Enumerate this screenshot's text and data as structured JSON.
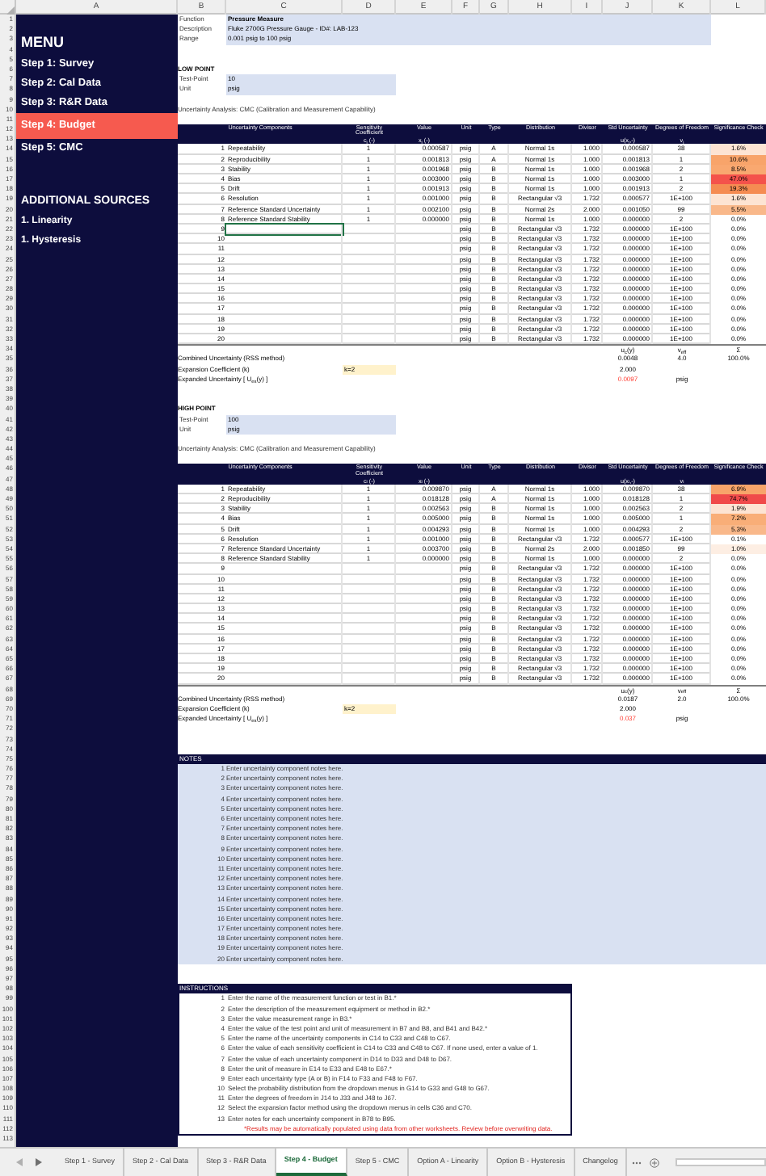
{
  "column_letters": [
    "A",
    "B",
    "C",
    "D",
    "E",
    "F",
    "G",
    "H",
    "I",
    "J",
    "K",
    "L"
  ],
  "row_numbers": [
    "1",
    "2",
    "3",
    "4",
    "5",
    "6",
    "7",
    "8",
    "9",
    "10",
    "11",
    "12",
    "13",
    "14",
    "15",
    "16",
    "17",
    "18",
    "19",
    "20",
    "21",
    "22",
    "23",
    "24",
    "25",
    "26",
    "27",
    "28",
    "29",
    "30",
    "31",
    "32",
    "33",
    "34",
    "35",
    "36",
    "37",
    "38",
    "39",
    "40",
    "41",
    "42",
    "43",
    "44",
    "45",
    "46",
    "47",
    "48",
    "49",
    "50",
    "51",
    "52",
    "53",
    "54",
    "55",
    "56",
    "57",
    "58",
    "59",
    "60",
    "61",
    "62",
    "63",
    "64",
    "65",
    "66",
    "67",
    "68",
    "69",
    "70",
    "71",
    "72",
    "73",
    "74",
    "75",
    "76",
    "77",
    "78",
    "79",
    "80",
    "81",
    "82",
    "83",
    "84",
    "85",
    "86",
    "87",
    "88",
    "89",
    "90",
    "91",
    "92",
    "93",
    "94",
    "95",
    "96",
    "97",
    "98",
    "99",
    "100",
    "101",
    "102",
    "103",
    "104",
    "105",
    "106",
    "107",
    "108",
    "109",
    "110",
    "111",
    "112",
    "113"
  ],
  "sidebar": {
    "title": "MENU",
    "items": [
      {
        "label": "Step 1: Survey",
        "selected": false
      },
      {
        "label": "Step 2: Cal Data",
        "selected": false
      },
      {
        "label": "Step 3: R&R Data",
        "selected": false
      },
      {
        "label": "Step 4: Budget",
        "selected": true
      },
      {
        "label": "Step 5: CMC",
        "selected": false
      }
    ],
    "section_title": "ADDITIONAL SOURCES",
    "links": [
      "1. Linearity",
      "1. Hysteresis"
    ]
  },
  "info": [
    {
      "label": "Function",
      "value": "Pressure Measure"
    },
    {
      "label": "Description",
      "value": "Fluke 2700G Pressure Gauge - ID#: LAB-123"
    },
    {
      "label": "Range",
      "value": "0.001 psig to 100 psig"
    }
  ],
  "low_point": {
    "heading": "LOW POINT",
    "test_point": {
      "label": "Test-Point",
      "value": "10"
    },
    "unit": {
      "label": "Unit",
      "value": "psig"
    },
    "analysis_title": "Uncertainty Analysis: CMC (Calibration and Measurement Capability)",
    "columns": [
      "Uncertainty Components",
      "Sensitivity Coefficient",
      "Value",
      "Unit",
      "Type",
      "Distribution",
      "Divisor",
      "Std Uncertainty",
      "Degrees of Freedom",
      "Significance Check"
    ],
    "symbols": {
      "coefficient": "c$_{i}$ (-)",
      "value": "x$_{i}$ (-)",
      "std": "u(x$_{i}$,-)",
      "dof": "v$_{i}$"
    },
    "rows": [
      {
        "n": "1",
        "name": "Repeatability",
        "ci": "1",
        "value": "0.000587",
        "unit": "psig",
        "type": "A",
        "dist": "Normal 1s",
        "divisor": "1.000",
        "std": "0.000587",
        "dof": "38",
        "sig": "1.6%",
        "color": "#fde4d3",
        "selected": false
      },
      {
        "n": "2",
        "name": "Reproducibility",
        "ci": "1",
        "value": "0.001813",
        "unit": "psig",
        "type": "A",
        "dist": "Normal 1s",
        "divisor": "1.000",
        "std": "0.001813",
        "dof": "1",
        "sig": "10.6%",
        "color": "#f8a46a",
        "selected": false
      },
      {
        "n": "3",
        "name": "Stability",
        "ci": "1",
        "value": "0.001968",
        "unit": "psig",
        "type": "B",
        "dist": "Normal 1s",
        "divisor": "1.000",
        "std": "0.001968",
        "dof": "2",
        "sig": "8.5%",
        "color": "#f9a870",
        "selected": false
      },
      {
        "n": "4",
        "name": "Bias",
        "ci": "1",
        "value": "0.003000",
        "unit": "psig",
        "type": "B",
        "dist": "Normal 1s",
        "divisor": "1.000",
        "std": "0.003000",
        "dof": "1",
        "sig": "47.0%",
        "color": "#f4524b",
        "selected": false
      },
      {
        "n": "5",
        "name": "Drift",
        "ci": "1",
        "value": "0.001913",
        "unit": "psig",
        "type": "B",
        "dist": "Normal 1s",
        "divisor": "1.000",
        "std": "0.001913",
        "dof": "2",
        "sig": "19.3%",
        "color": "#f58c52",
        "selected": false
      },
      {
        "n": "6",
        "name": "Resolution",
        "ci": "1",
        "value": "0.001000",
        "unit": "psig",
        "type": "B",
        "dist": "Rectangular √3",
        "divisor": "1.732",
        "std": "0.000577",
        "dof": "1E+100",
        "sig": "1.6%",
        "color": "#fde4d3",
        "selected": false
      },
      {
        "n": "7",
        "name": "Reference Standard Uncertainty",
        "ci": "1",
        "value": "0.002100",
        "unit": "psig",
        "type": "B",
        "dist": "Normal 2s",
        "divisor": "2.000",
        "std": "0.001050",
        "dof": "99",
        "sig": "5.5%",
        "color": "#f9b88a",
        "selected": false
      },
      {
        "n": "8",
        "name": "Reference Standard Stability",
        "ci": "1",
        "value": "0.000000",
        "unit": "psig",
        "type": "B",
        "dist": "Normal 1s",
        "divisor": "1.000",
        "std": "0.000000",
        "dof": "2",
        "sig": "0.0%",
        "color": "#ffffff",
        "selected": false
      },
      {
        "n": "9",
        "unit": "psig",
        "type": "B",
        "dist": "Rectangular √3",
        "divisor": "1.732",
        "std": "0.000000",
        "dof": "1E+100",
        "sig": "0.0%",
        "color": "#ffffff",
        "selected": true
      },
      {
        "n": "10",
        "unit": "psig",
        "type": "B",
        "dist": "Rectangular √3",
        "divisor": "1.732",
        "std": "0.000000",
        "dof": "1E+100",
        "sig": "0.0%",
        "color": "#ffffff",
        "selected": false
      },
      {
        "n": "11",
        "unit": "psig",
        "type": "B",
        "dist": "Rectangular √3",
        "divisor": "1.732",
        "std": "0.000000",
        "dof": "1E+100",
        "sig": "0.0%",
        "color": "#ffffff",
        "selected": false
      },
      {
        "n": "12",
        "unit": "psig",
        "type": "B",
        "dist": "Rectangular √3",
        "divisor": "1.732",
        "std": "0.000000",
        "dof": "1E+100",
        "sig": "0.0%",
        "color": "#ffffff",
        "selected": false
      },
      {
        "n": "13",
        "unit": "psig",
        "type": "B",
        "dist": "Rectangular √3",
        "divisor": "1.732",
        "std": "0.000000",
        "dof": "1E+100",
        "sig": "0.0%",
        "color": "#ffffff",
        "selected": false
      },
      {
        "n": "14",
        "unit": "psig",
        "type": "B",
        "dist": "Rectangular √3",
        "divisor": "1.732",
        "std": "0.000000",
        "dof": "1E+100",
        "sig": "0.0%",
        "color": "#ffffff",
        "selected": false
      },
      {
        "n": "15",
        "unit": "psig",
        "type": "B",
        "dist": "Rectangular √3",
        "divisor": "1.732",
        "std": "0.000000",
        "dof": "1E+100",
        "sig": "0.0%",
        "color": "#ffffff",
        "selected": false
      },
      {
        "n": "16",
        "unit": "psig",
        "type": "B",
        "dist": "Rectangular √3",
        "divisor": "1.732",
        "std": "0.000000",
        "dof": "1E+100",
        "sig": "0.0%",
        "color": "#ffffff",
        "selected": false
      },
      {
        "n": "17",
        "unit": "psig",
        "type": "B",
        "dist": "Rectangular √3",
        "divisor": "1.732",
        "std": "0.000000",
        "dof": "1E+100",
        "sig": "0.0%",
        "color": "#ffffff",
        "selected": false
      },
      {
        "n": "18",
        "unit": "psig",
        "type": "B",
        "dist": "Rectangular √3",
        "divisor": "1.732",
        "std": "0.000000",
        "dof": "1E+100",
        "sig": "0.0%",
        "color": "#ffffff",
        "selected": false
      },
      {
        "n": "19",
        "unit": "psig",
        "type": "B",
        "dist": "Rectangular √3",
        "divisor": "1.732",
        "std": "0.000000",
        "dof": "1E+100",
        "sig": "0.0%",
        "color": "#ffffff",
        "selected": false
      },
      {
        "n": "20",
        "unit": "psig",
        "type": "B",
        "dist": "Rectangular √3",
        "divisor": "1.732",
        "std": "0.000000",
        "dof": "1E+100",
        "sig": "0.0%",
        "color": "#ffffff",
        "selected": false
      }
    ],
    "summary": {
      "symbol_uc": "u$_{c}$(y)",
      "symbol_veff": "v$_{eff}$",
      "symbol_sum": "Σ",
      "combined_label": "Combined Uncertainty (RSS method)",
      "combined": "0.0048",
      "veff": "4.0",
      "sum": "100.0%",
      "expansion_label": "Expansion Coefficient (k)",
      "k_method": "k=2",
      "k": "2.000",
      "expanded_label": "Expanded Uncertainty [ U$_{ex}$(y) ]",
      "expanded": "0.0097",
      "expanded_unit": "psig"
    }
  },
  "high_point": {
    "heading": "HIGH POINT",
    "test_point": {
      "label": "Test-Point",
      "value": "100"
    },
    "unit": {
      "label": "Unit",
      "value": "psig"
    },
    "analysis_title": "Uncertainty Analysis: CMC (Calibration and Measurement Capability)",
    "columns": [
      "Uncertainty Components",
      "Sensitivity Coefficient",
      "Value",
      "Unit",
      "Type",
      "Distribution",
      "Divisor",
      "Std Uncertainty",
      "Degrees of Freedom",
      "Significance Check"
    ],
    "symbols": {
      "coefficient": "c$_{i}$ (-)",
      "value": "x$_{i}$ (-)",
      "std": "u(x$_{i}$,-)",
      "dof": "v$_{i}$"
    },
    "rows": [
      {
        "n": "1",
        "name": "Repeatability",
        "ci": "1",
        "value": "0.009870",
        "unit": "psig",
        "type": "A",
        "dist": "Normal 1s",
        "divisor": "1.000",
        "std": "0.009870",
        "dof": "38",
        "sig": "6.9%",
        "color": "#f8a46a",
        "selected": false
      },
      {
        "n": "2",
        "name": "Reproducibility",
        "ci": "1",
        "value": "0.018128",
        "unit": "psig",
        "type": "A",
        "dist": "Normal 1s",
        "divisor": "1.000",
        "std": "0.018128",
        "dof": "1",
        "sig": "74.7%",
        "color": "#f04a4a",
        "selected": false
      },
      {
        "n": "3",
        "name": "Stability",
        "ci": "1",
        "value": "0.002563",
        "unit": "psig",
        "type": "B",
        "dist": "Normal 1s",
        "divisor": "1.000",
        "std": "0.002563",
        "dof": "2",
        "sig": "1.9%",
        "color": "#fde4d3",
        "selected": false
      },
      {
        "n": "4",
        "name": "Bias",
        "ci": "1",
        "value": "0.005000",
        "unit": "psig",
        "type": "B",
        "dist": "Normal 1s",
        "divisor": "1.000",
        "std": "0.005000",
        "dof": "1",
        "sig": "7.2%",
        "color": "#f9ae78",
        "selected": false
      },
      {
        "n": "5",
        "name": "Drift",
        "ci": "1",
        "value": "0.004293",
        "unit": "psig",
        "type": "B",
        "dist": "Normal 1s",
        "divisor": "1.000",
        "std": "0.004293",
        "dof": "2",
        "sig": "5.3%",
        "color": "#f9b88a",
        "selected": false
      },
      {
        "n": "6",
        "name": "Resolution",
        "ci": "1",
        "value": "0.001000",
        "unit": "psig",
        "type": "B",
        "dist": "Rectangular √3",
        "divisor": "1.732",
        "std": "0.000577",
        "dof": "1E+100",
        "sig": "0.1%",
        "color": "#ffffff",
        "selected": false
      },
      {
        "n": "7",
        "name": "Reference Standard Uncertainty",
        "ci": "1",
        "value": "0.003700",
        "unit": "psig",
        "type": "B",
        "dist": "Normal 2s",
        "divisor": "2.000",
        "std": "0.001850",
        "dof": "99",
        "sig": "1.0%",
        "color": "#fdeee3",
        "selected": false
      },
      {
        "n": "8",
        "name": "Reference Standard Stability",
        "ci": "1",
        "value": "0.000000",
        "unit": "psig",
        "type": "B",
        "dist": "Normal 1s",
        "divisor": "1.000",
        "std": "0.000000",
        "dof": "2",
        "sig": "0.0%",
        "color": "#ffffff",
        "selected": false
      },
      {
        "n": "9",
        "unit": "psig",
        "type": "B",
        "dist": "Rectangular √3",
        "divisor": "1.732",
        "std": "0.000000",
        "dof": "1E+100",
        "sig": "0.0%",
        "color": "#ffffff",
        "selected": false
      },
      {
        "n": "10",
        "unit": "psig",
        "type": "B",
        "dist": "Rectangular √3",
        "divisor": "1.732",
        "std": "0.000000",
        "dof": "1E+100",
        "sig": "0.0%",
        "color": "#ffffff",
        "selected": false
      },
      {
        "n": "11",
        "unit": "psig",
        "type": "B",
        "dist": "Rectangular √3",
        "divisor": "1.732",
        "std": "0.000000",
        "dof": "1E+100",
        "sig": "0.0%",
        "color": "#ffffff",
        "selected": false
      },
      {
        "n": "12",
        "unit": "psig",
        "type": "B",
        "dist": "Rectangular √3",
        "divisor": "1.732",
        "std": "0.000000",
        "dof": "1E+100",
        "sig": "0.0%",
        "color": "#ffffff",
        "selected": false
      },
      {
        "n": "13",
        "unit": "psig",
        "type": "B",
        "dist": "Rectangular √3",
        "divisor": "1.732",
        "std": "0.000000",
        "dof": "1E+100",
        "sig": "0.0%",
        "color": "#ffffff",
        "selected": false
      },
      {
        "n": "14",
        "unit": "psig",
        "type": "B",
        "dist": "Rectangular √3",
        "divisor": "1.732",
        "std": "0.000000",
        "dof": "1E+100",
        "sig": "0.0%",
        "color": "#ffffff",
        "selected": false
      },
      {
        "n": "15",
        "unit": "psig",
        "type": "B",
        "dist": "Rectangular √3",
        "divisor": "1.732",
        "std": "0.000000",
        "dof": "1E+100",
        "sig": "0.0%",
        "color": "#ffffff",
        "selected": false
      },
      {
        "n": "16",
        "unit": "psig",
        "type": "B",
        "dist": "Rectangular √3",
        "divisor": "1.732",
        "std": "0.000000",
        "dof": "1E+100",
        "sig": "0.0%",
        "color": "#ffffff",
        "selected": false
      },
      {
        "n": "17",
        "unit": "psig",
        "type": "B",
        "dist": "Rectangular √3",
        "divisor": "1.732",
        "std": "0.000000",
        "dof": "1E+100",
        "sig": "0.0%",
        "color": "#ffffff",
        "selected": false
      },
      {
        "n": "18",
        "unit": "psig",
        "type": "B",
        "dist": "Rectangular √3",
        "divisor": "1.732",
        "std": "0.000000",
        "dof": "1E+100",
        "sig": "0.0%",
        "color": "#ffffff",
        "selected": false
      },
      {
        "n": "19",
        "unit": "psig",
        "type": "B",
        "dist": "Rectangular √3",
        "divisor": "1.732",
        "std": "0.000000",
        "dof": "1E+100",
        "sig": "0.0%",
        "color": "#ffffff",
        "selected": false
      },
      {
        "n": "20",
        "unit": "psig",
        "type": "B",
        "dist": "Rectangular √3",
        "divisor": "1.732",
        "std": "0.000000",
        "dof": "1E+100",
        "sig": "0.0%",
        "color": "#ffffff",
        "selected": false
      }
    ],
    "summary": {
      "symbol_uc": "u$_{c}$(y)",
      "symbol_veff": "v$_{eff}$",
      "symbol_sum": "Σ",
      "combined_label": "Combined Uncertainty (RSS method)",
      "combined": "0.0187",
      "veff": "2.0",
      "sum": "100.0%",
      "expansion_label": "Expansion Coefficient (k)",
      "k_method": "k=2",
      "k": "2.000",
      "expanded_label": "Expanded Uncertainty [ U$_{ex}$(y) ]",
      "expanded": "0.037",
      "expanded_unit": "psig"
    }
  },
  "notes": {
    "title": "NOTES",
    "items": [
      {
        "n": "1",
        "text": "Enter uncertainty component notes here."
      },
      {
        "n": "2",
        "text": "Enter uncertainty component notes here."
      },
      {
        "n": "3",
        "text": "Enter uncertainty component notes here."
      },
      {
        "n": "4",
        "text": "Enter uncertainty component notes here."
      },
      {
        "n": "5",
        "text": "Enter uncertainty component notes here."
      },
      {
        "n": "6",
        "text": "Enter uncertainty component notes here."
      },
      {
        "n": "7",
        "text": "Enter uncertainty component notes here."
      },
      {
        "n": "8",
        "text": "Enter uncertainty component notes here."
      },
      {
        "n": "9",
        "text": "Enter uncertainty component notes here."
      },
      {
        "n": "10",
        "text": "Enter uncertainty component notes here."
      },
      {
        "n": "11",
        "text": "Enter uncertainty component notes here."
      },
      {
        "n": "12",
        "text": "Enter uncertainty component notes here."
      },
      {
        "n": "13",
        "text": "Enter uncertainty component notes here."
      },
      {
        "n": "14",
        "text": "Enter uncertainty component notes here."
      },
      {
        "n": "15",
        "text": "Enter uncertainty component notes here."
      },
      {
        "n": "16",
        "text": "Enter uncertainty component notes here."
      },
      {
        "n": "17",
        "text": "Enter uncertainty component notes here."
      },
      {
        "n": "18",
        "text": "Enter uncertainty component notes here."
      },
      {
        "n": "19",
        "text": "Enter uncertainty component notes here."
      },
      {
        "n": "20",
        "text": "Enter uncertainty component notes here."
      }
    ]
  },
  "instructions": {
    "title": "INSTRUCTIONS",
    "items": [
      {
        "n": "1",
        "text": "Enter the name of the measurement function or test in B1.*"
      },
      {
        "n": "2",
        "text": "Enter the description of the measurement equipment or method in B2.*"
      },
      {
        "n": "3",
        "text": "Enter the value measurement range in B3.*"
      },
      {
        "n": "4",
        "text": "Enter the value of the test point and unit of measurement in B7 and B8, and B41 and B42.*"
      },
      {
        "n": "5",
        "text": "Enter the name of the uncertainty components in C14 to C33 and C48 to C67."
      },
      {
        "n": "6",
        "text": "Enter the value of each sensitivity coefficient in C14 to C33 and C48 to C67. If none used, enter a value of 1."
      },
      {
        "n": "7",
        "text": "Enter the value of each uncertainty component in D14 to D33 and D48 to D67."
      },
      {
        "n": "8",
        "text": "Enter the unit of measure in E14 to E33 and E48 to E67.*"
      },
      {
        "n": "9",
        "text": "Enter each uncertainty type (A or B) in F14 to F33 and F48 to F67."
      },
      {
        "n": "10",
        "text": "Select the probability distribution from the dropdown menus in G14 to G33 and G48 to G67."
      },
      {
        "n": "11",
        "text": "Enter the degrees of freedom in J14 to J33 and J48 to J67."
      },
      {
        "n": "12",
        "text": "Select the expansion factor method using the dropdown menus in cells C36 and C70."
      },
      {
        "n": "13",
        "text": "Enter notes for each uncertainty component in B78 to B95."
      }
    ],
    "footnote": "*Results may be automatically populated using data from other worksheets. Review before overwriting data."
  },
  "sheet_tabs": [
    {
      "label": "Step 1 - Survey",
      "selected": false
    },
    {
      "label": "Step 2 - Cal Data",
      "selected": false
    },
    {
      "label": "Step 3 - R&R Data",
      "selected": false
    },
    {
      "label": "Step 4 - Budget",
      "selected": true
    },
    {
      "label": "Step 5 - CMC",
      "selected": false
    },
    {
      "label": "Option A - Linearity",
      "selected": false
    },
    {
      "label": "Option B - Hysteresis",
      "selected": false
    },
    {
      "label": "Changelog",
      "selected": false
    }
  ]
}
